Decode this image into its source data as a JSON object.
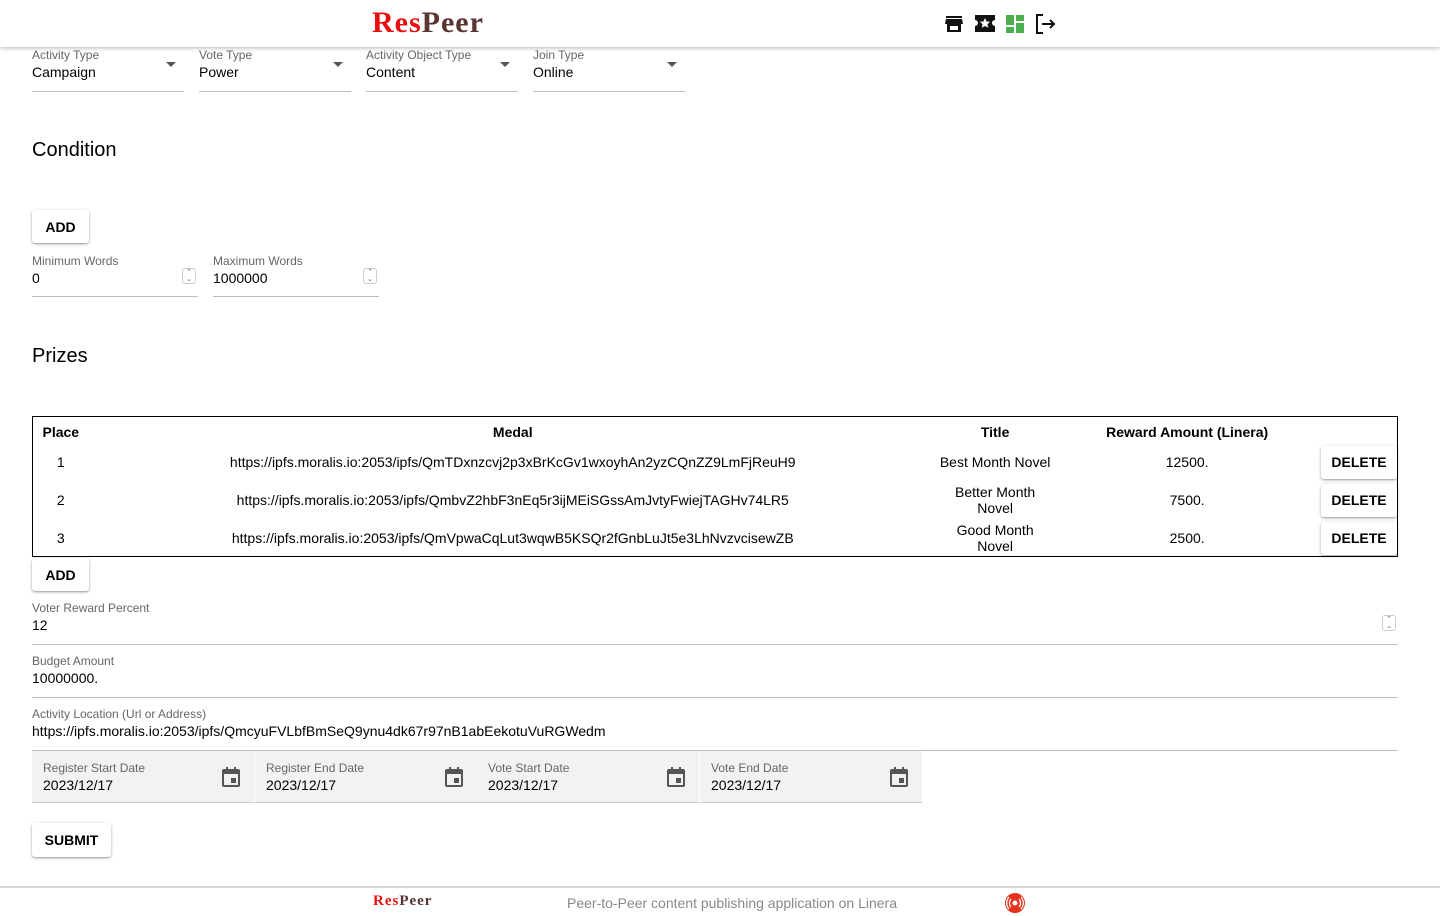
{
  "header": {
    "logo_res": "Res",
    "logo_peer": "Peer",
    "icons": [
      "store-icon",
      "ticket-star-icon",
      "dashboard-icon",
      "logout-icon"
    ]
  },
  "selects": [
    {
      "label": "Activity Type",
      "value": "Campaign"
    },
    {
      "label": "Vote Type",
      "value": "Power"
    },
    {
      "label": "Activity Object Type",
      "value": "Content"
    },
    {
      "label": "Join Type",
      "value": "Online"
    }
  ],
  "condition": {
    "title": "Condition",
    "add_label": "ADD",
    "min": {
      "label": "Minimum Words",
      "value": "0"
    },
    "max": {
      "label": "Maximum Words",
      "value": "1000000"
    }
  },
  "prizes": {
    "title": "Prizes",
    "columns": [
      "Place",
      "Medal",
      "Title",
      "Reward Amount (Linera)"
    ],
    "rows": [
      {
        "place": "1",
        "medal": "https://ipfs.moralis.io:2053/ipfs/QmTDxnzcvj2p3xBrKcGv1wxoyhAn2yzCQnZZ9LmFjReuH9",
        "title": "Best Month Novel",
        "reward": "12500.",
        "delete": "DELETE"
      },
      {
        "place": "2",
        "medal": "https://ipfs.moralis.io:2053/ipfs/QmbvZ2hbF3nEq5r3ijMEiSGssAmJvtyFwiejTAGHv74LR5",
        "title": "Better Month Novel",
        "reward": "7500.",
        "delete": "DELETE"
      },
      {
        "place": "3",
        "medal": "https://ipfs.moralis.io:2053/ipfs/QmVpwaCqLut3wqwB5KSQr2fGnbLuJt5e3LhNvzvcisewZB",
        "title": "Good Month Novel",
        "reward": "2500.",
        "delete": "DELETE"
      }
    ],
    "add_label": "ADD"
  },
  "voter_reward": {
    "label": "Voter Reward Percent",
    "value": "12"
  },
  "budget": {
    "label": "Budget Amount",
    "value": "10000000."
  },
  "location": {
    "label": "Activity Location (Url or Address)",
    "value": "https://ipfs.moralis.io:2053/ipfs/QmcyuFVLbfBmSeQ9ynu4dk67r97nB1abEekotuVuRGWedm"
  },
  "dates": [
    {
      "label": "Register Start Date",
      "value": "2023/12/17"
    },
    {
      "label": "Register End Date",
      "value": "2023/12/17"
    },
    {
      "label": "Vote Start Date",
      "value": "2023/12/17"
    },
    {
      "label": "Vote End Date",
      "value": "2023/12/17"
    }
  ],
  "submit_label": "SUBMIT",
  "footer": {
    "logo_res": "Res",
    "logo_peer": "Peer",
    "tagline": "Peer-to-Peer content publishing application on Linera"
  },
  "colors": {
    "brand_red": "#e80f0f",
    "brand_brown": "#5a3333",
    "dashboard_green": "#4caf50",
    "linera_red": "#e8321e"
  }
}
